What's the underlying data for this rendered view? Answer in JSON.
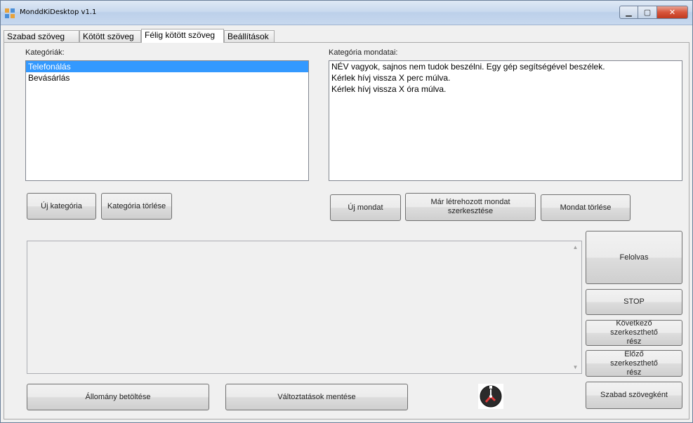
{
  "window": {
    "title": "MonddKiDesktop v1.1",
    "controls": {
      "minimize": "▁",
      "maximize": "▢",
      "close": "✕"
    }
  },
  "tabs": [
    {
      "label": "Szabad szöveg"
    },
    {
      "label": "Kötött szöveg"
    },
    {
      "label": "Félig kötött szöveg"
    },
    {
      "label": "Beállítások"
    }
  ],
  "categories": {
    "label": "Kategóriák:",
    "items": [
      "Telefonálás",
      "Bevásárlás"
    ],
    "selected_index": 0,
    "new_button": "Új kategória",
    "delete_button": "Kategória törlése"
  },
  "sentences": {
    "label": "Kategória mondatai:",
    "items": [
      "NÉV vagyok, sajnos nem tudok beszélni. Egy gép segítségével beszélek.",
      "Kérlek hívj vissza X perc múlva.",
      "Kérlek hívj vissza X óra múlva."
    ],
    "new_button": "Új mondat",
    "edit_button": "Már létrehozott mondat szerkesztése",
    "delete_button": "Mondat törlése"
  },
  "editor": {
    "value": ""
  },
  "side_buttons": {
    "read": "Felolvas",
    "stop": "STOP",
    "next": "Következő szerkeszthető rész",
    "prev": "Előző szerkeszthető rész",
    "as_free_text": "Szabad szövegként"
  },
  "bottom_buttons": {
    "load_file": "Állomány betöltése",
    "save_changes": "Változtatások mentése"
  },
  "icons": {
    "app": "app-icon",
    "clock": "clock-icon",
    "scroll_up": "scroll-up-arrow-icon",
    "scroll_down": "scroll-down-arrow-icon"
  },
  "colors": {
    "selection": "#3399ff",
    "close_button": "#c8432a"
  }
}
